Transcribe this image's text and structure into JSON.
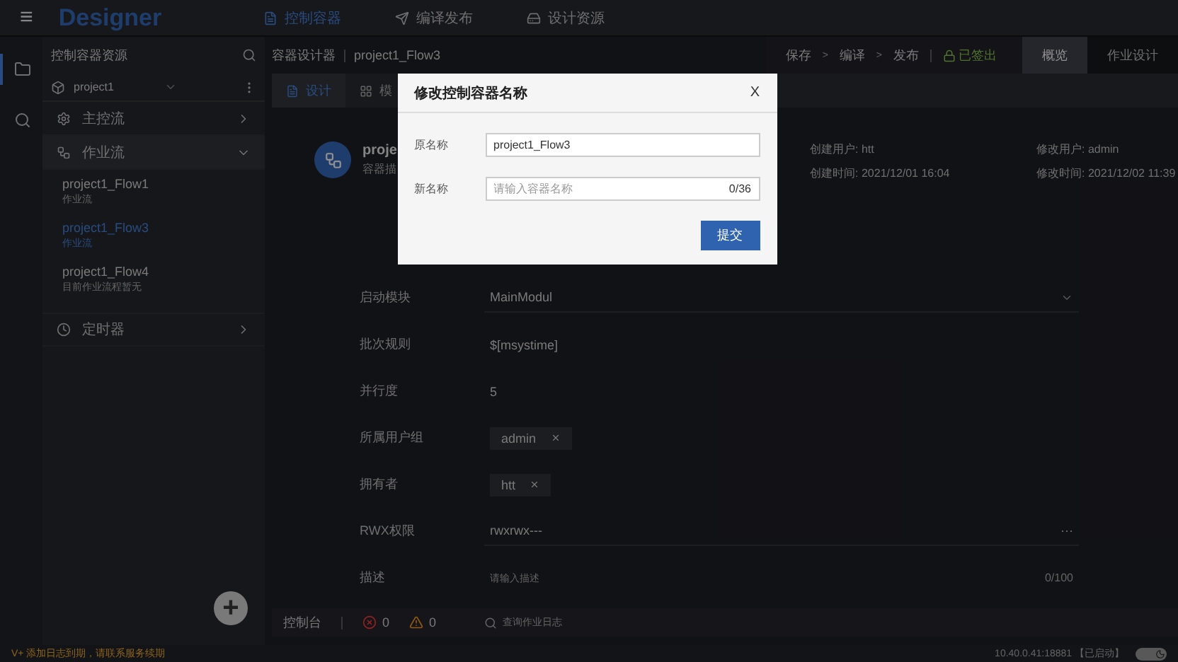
{
  "topbar": {
    "menu": "≡",
    "logo": "Designer",
    "nav": [
      {
        "label": "控制容器",
        "selected": true
      },
      {
        "label": "编译发布",
        "selected": false
      },
      {
        "label": "设计资源",
        "selected": false
      }
    ]
  },
  "rail": [
    {
      "selected": true
    },
    {
      "selected": false
    }
  ],
  "sidebar": {
    "title": "控制容器资源",
    "project": "project1",
    "groups": [
      {
        "label": "主控流",
        "expanded": false
      },
      {
        "label": "作业流",
        "expanded": true,
        "children": [
          {
            "name": "project1_Flow1",
            "sub": "作业流",
            "selected": false
          },
          {
            "name": "project1_Flow3",
            "sub": "作业流",
            "selected": true
          },
          {
            "name": "project1_Flow4",
            "sub": "目前作业流程暂无",
            "selected": false
          }
        ]
      },
      {
        "label": "定时器",
        "expanded": false
      }
    ],
    "add": "+"
  },
  "breadcrumb": [
    "容器设计器",
    "project1_Flow3"
  ],
  "toolbar": {
    "steps": [
      "保存",
      "编译",
      "发布"
    ],
    "sep": ">",
    "status": "已签出",
    "tabs": [
      {
        "label": "概览",
        "selected": true
      },
      {
        "label": "作业设计",
        "selected": false
      }
    ]
  },
  "subtabs": [
    {
      "label": "设计",
      "selected": true
    },
    {
      "label": "模",
      "selected": false
    }
  ],
  "header": {
    "title": "proje",
    "subtitle": "容器描"
  },
  "info": [
    {
      "label": "创建用户:",
      "value": "htt"
    },
    {
      "label": "修改用户:",
      "value": "admin"
    },
    {
      "label": "创建时间:",
      "value": "2021/12/01 16:04"
    },
    {
      "label": "修改时间:",
      "value": "2021/12/02 11:39"
    }
  ],
  "form": [
    {
      "label": "启动模块",
      "kind": "select",
      "value": "MainModul"
    },
    {
      "label": "批次规则",
      "kind": "text",
      "value": "$[msystime]"
    },
    {
      "label": "并行度",
      "kind": "text",
      "value": "5"
    },
    {
      "label": "所属用户组",
      "kind": "tag",
      "value": "admin"
    },
    {
      "label": "拥有者",
      "kind": "tag",
      "value": "htt"
    },
    {
      "label": "RWX权限",
      "kind": "more",
      "value": "rwxrwx---",
      "more": "···"
    },
    {
      "label": "描述",
      "kind": "textarea",
      "placeholder": "请输入描述",
      "count": "0/100"
    }
  ],
  "console": {
    "label": "控制台",
    "errors": "0",
    "warnings": "0",
    "search_placeholder": "查询作业日志"
  },
  "status_bar": {
    "notice": "V+ 添加日志到期，请联系服务续期",
    "server": "10.40.0.41:18881 【已启动】",
    "dark_mode": true
  },
  "dialog": {
    "title": "修改控制容器名称",
    "close": "X",
    "fields": [
      {
        "label": "原名称",
        "value": "project1_Flow3"
      },
      {
        "label": "新名称",
        "placeholder": "请输入容器名称",
        "count": "0/36"
      }
    ],
    "submit": "提交"
  }
}
